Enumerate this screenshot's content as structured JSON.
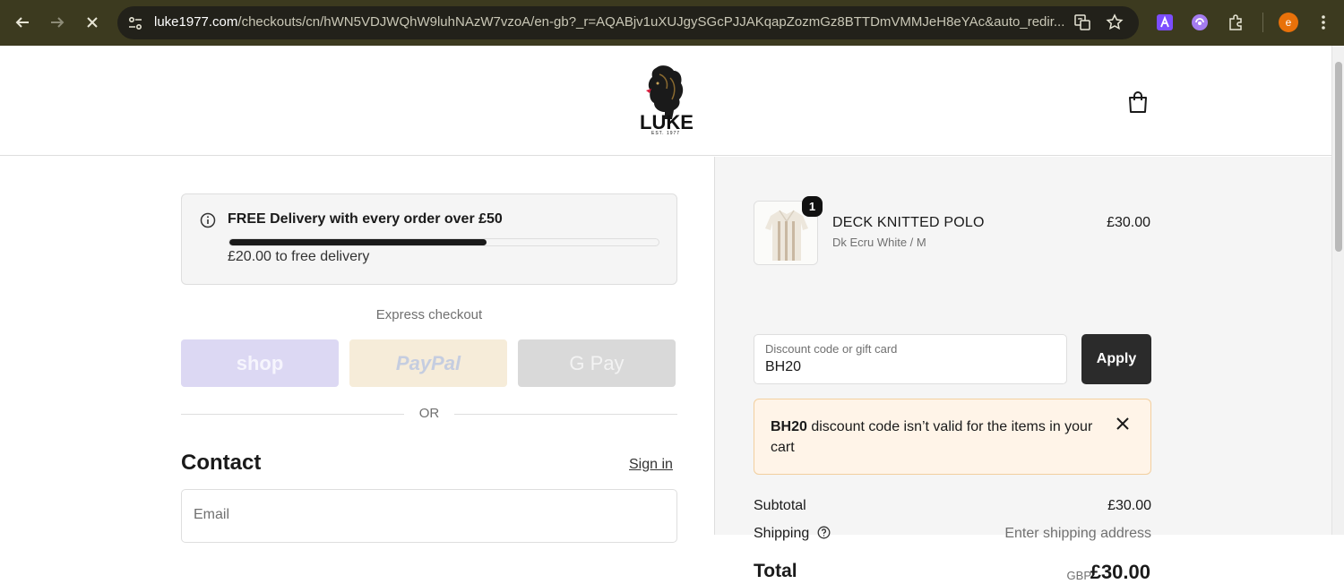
{
  "browser": {
    "url_host": "luke1977.com",
    "url_rest": "/checkouts/cn/hWN5VDJWQhW9luhNAzW7vzoA/en-gb?_r=AQABjv1uXUJgySGcPJJAKqapZozmGz8BTTDmVMMJeH8eYAc&auto_redir...",
    "profile_initial": "e",
    "colors": {
      "chrome_bg": "#3c3a1f",
      "omnibox_bg": "#22211a",
      "profile": "#e8710a"
    }
  },
  "header": {
    "brand": "LUKE",
    "brand_est": "EST. 1977",
    "icons": {
      "logo": "lion-logo-icon",
      "cart": "shopping-bag-icon"
    }
  },
  "free_delivery": {
    "title": "FREE Delivery with every order over £50",
    "remaining": "£20.00 to free delivery",
    "progress_fraction": 0.6
  },
  "express": {
    "label": "Express checkout",
    "buttons": [
      "shop",
      "PayPal",
      "G Pay"
    ],
    "or": "OR"
  },
  "contact": {
    "heading": "Contact",
    "sign_in": "Sign in",
    "email_placeholder": "Email"
  },
  "order": {
    "item": {
      "quantity": "1",
      "name": "DECK KNITTED POLO",
      "variant": "Dk Ecru White / M",
      "price": "£30.00"
    },
    "discount": {
      "label": "Discount code or gift card",
      "value": "BH20",
      "apply": "Apply"
    },
    "alert": {
      "code": "BH20",
      "message": " discount code isn’t valid for the items in your cart"
    },
    "summary": {
      "subtotal_label": "Subtotal",
      "subtotal_value": "£30.00",
      "shipping_label": "Shipping",
      "shipping_value": "Enter shipping address",
      "total_label": "Total",
      "currency": "GBP",
      "total_value": "£30.00"
    }
  }
}
